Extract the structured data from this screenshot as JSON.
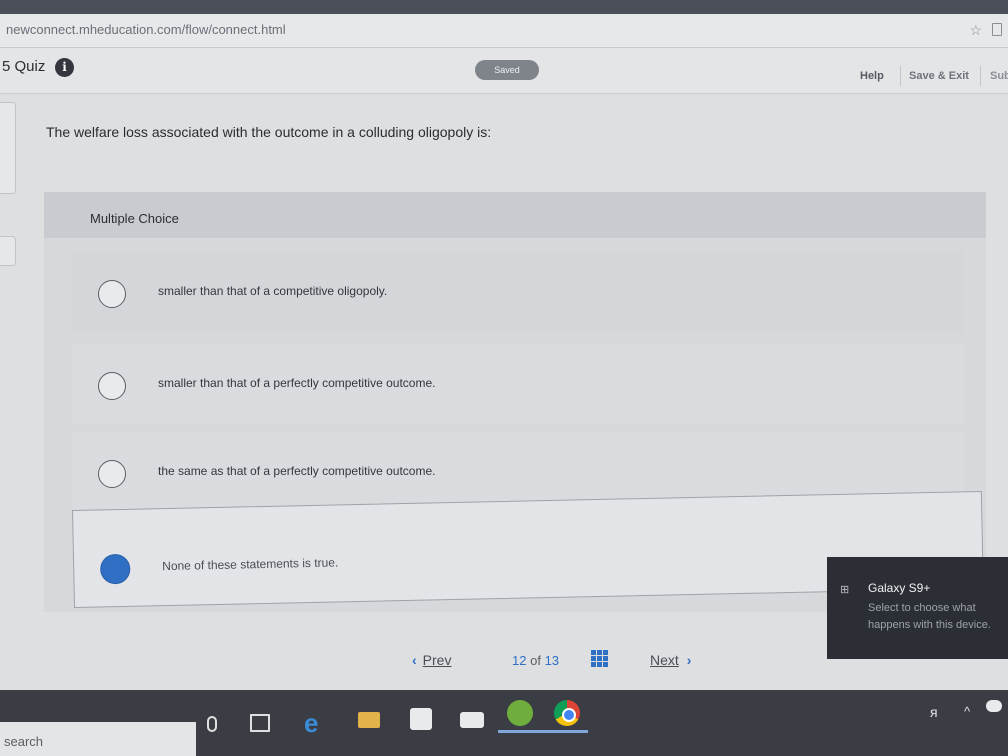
{
  "browser": {
    "url": "newconnect.mheducation.com/flow/connect.html",
    "star_icon": "star-icon",
    "extension_icon": "extension-icon"
  },
  "header": {
    "quiz_title": "5 Quiz",
    "info_icon": "i",
    "saved_badge": "Saved",
    "help": "Help",
    "save_exit": "Save & Exit",
    "submit": "Sub"
  },
  "question": {
    "text": "The welfare loss associated with the outcome in a colluding oligopoly is:",
    "type_label": "Multiple Choice",
    "options": [
      {
        "label": "smaller than that of a competitive oligopoly.",
        "selected": false
      },
      {
        "label": "smaller than that of a perfectly competitive outcome.",
        "selected": false
      },
      {
        "label": "the same as that of a perfectly competitive outcome.",
        "selected": false
      },
      {
        "label": "None of these statements is true.",
        "selected": true
      }
    ]
  },
  "nav": {
    "prev": "Prev",
    "prev_chevron": "‹",
    "current": "12",
    "of": "of",
    "total": "13",
    "next": "Next",
    "next_chevron": "›"
  },
  "toast": {
    "title": "Galaxy S9+",
    "body": "Select to choose what happens with this device.",
    "icon": "device-icon"
  },
  "taskbar": {
    "search_label": "search"
  },
  "colors": {
    "accent": "#2f6fc4",
    "saved_badge": "#7f838a",
    "taskbar": "#3a3d44"
  }
}
